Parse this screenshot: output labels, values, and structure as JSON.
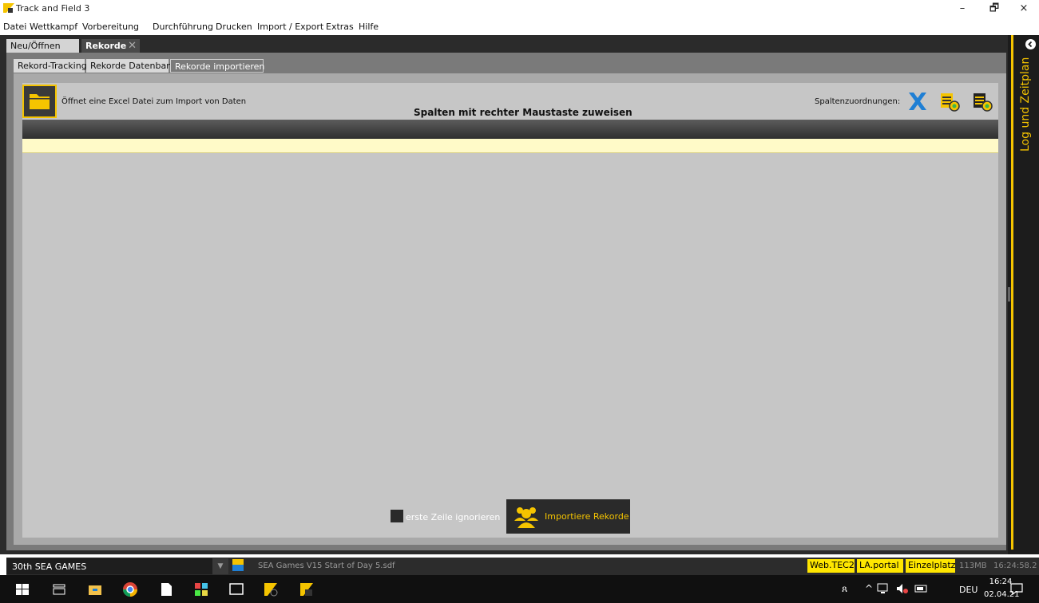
{
  "window": {
    "title": "Track and Field 3",
    "minimize": "–",
    "maximize": "🗗",
    "close": "×"
  },
  "menu": [
    "Datei",
    "Wettkampf",
    "Vorbereitung",
    "Durchführung",
    "Drucken",
    "Import / Export",
    "Extras",
    "Hilfe"
  ],
  "outer_tabs": {
    "tab1": "Neu/Öffnen",
    "tab2": "Rekorde",
    "close": "✕"
  },
  "inner_tabs": {
    "tab1": "Rekord-Tracking",
    "tab2": "Rekorde Datenbank",
    "tab3": "Rekorde importieren"
  },
  "import_panel": {
    "open_hint": "Öffnet eine Excel Datei zum Import von Daten",
    "assign_hint": "Spalten mit rechter Maustaste zuweisen",
    "mapping_label": "Spaltenzuordnungen:",
    "ignore_first_row": "erste Zeile ignorieren",
    "import_button": "Importiere Rekorde"
  },
  "right_rail": {
    "label": "Log und Zeitplan"
  },
  "status": {
    "meet": "30th SEA GAMES",
    "db_file": "SEA Games V15 Start of Day 5.sdf",
    "badge1": "Web.TEC2",
    "badge2": "LA.portal",
    "badge3": "Einzelplatz",
    "memory": "113MB",
    "time": "16:24:58.2"
  },
  "tray": {
    "lang": "DEU",
    "time": "16:24",
    "date": "02.04.21"
  },
  "colors": {
    "accent": "#f5c400",
    "frame": "#2b2b2b",
    "panel": "#c6c6c6",
    "row_highlight": "#fffac8"
  }
}
